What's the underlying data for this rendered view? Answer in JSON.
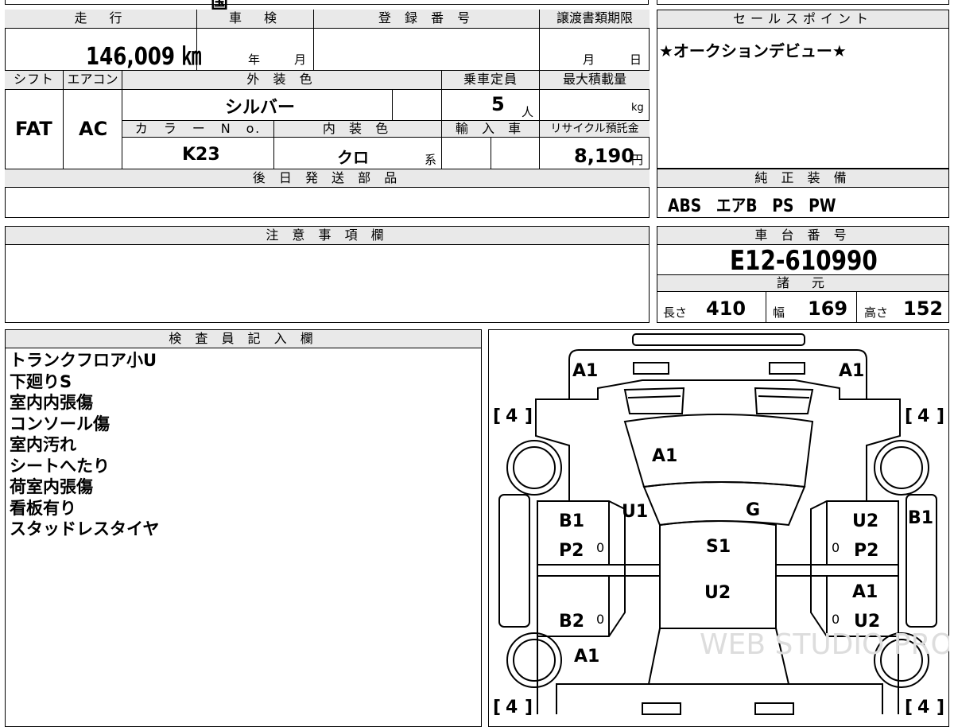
{
  "top_partial": {
    "item1": "国",
    "item2": "月",
    "item3": ""
  },
  "mileage": {
    "header": "走　行",
    "value": "146,009 ㎞"
  },
  "shaken": {
    "header": "車　検",
    "year": "年",
    "month": "月"
  },
  "registration": {
    "header": "登 録 番 号",
    "value": ""
  },
  "transfer": {
    "header": "譲渡書類期限",
    "month": "月",
    "day": "日"
  },
  "sales_point": {
    "header": "セールスポイント",
    "text": "★オークションデビュー★"
  },
  "shift": {
    "header": "シフト",
    "value": "FAT"
  },
  "aircon": {
    "header": "エアコン",
    "value": "AC"
  },
  "exterior_color": {
    "header": "外 装 色",
    "value": "シルバー"
  },
  "capacity": {
    "header": "乗車定員",
    "value": "5",
    "unit": "人"
  },
  "max_load": {
    "header": "最大積載量",
    "unit": "kg"
  },
  "color_no": {
    "header": "カ　ラ　ー　N　o.",
    "value": "K23"
  },
  "interior_color": {
    "header": "内 装 色",
    "value": "クロ",
    "suffix": "系"
  },
  "import": {
    "header": "輸 入 車"
  },
  "recycle": {
    "header": "リサイクル預託金",
    "value": "8,190",
    "unit": "円"
  },
  "later_parts": {
    "header": "後 日 発 送 部 品"
  },
  "genuine_equipment": {
    "header": "純 正 装 備",
    "value": "ABS　エアB　PS　PW"
  },
  "notes": {
    "header": "注 意 事 項 欄"
  },
  "chassis": {
    "header": "車 台 番 号",
    "value": "E12-610990"
  },
  "specs": {
    "header": "諸　元",
    "length_label": "長さ",
    "length": "410",
    "width_label": "幅",
    "width": "169",
    "height_label": "高さ",
    "height": "152"
  },
  "inspector": {
    "header": "検 査 員 記 入 欄",
    "lines": [
      "トランクフロア小U",
      "下廻りS",
      "室内内張傷",
      "コンソール傷",
      "室内汚れ",
      "シートへたり",
      "荷室内張傷",
      "看板有り",
      "スタッドレスタイヤ"
    ]
  },
  "diagram": {
    "front_left": "A1",
    "front_right": "A1",
    "tire_fl": "4",
    "tire_fr": "4",
    "tire_rl": "4",
    "tire_rr": "4",
    "hood": "A1",
    "fender_left": "U1",
    "fender_right": "G",
    "door_fl_a": "B1",
    "door_fl_b": "P2",
    "roof": "S1",
    "door_fr_a": "U2",
    "door_fr_b": "P2",
    "side_right": "B1",
    "door_rl": "B2",
    "rear_left": "A1",
    "roof_rear": "U2",
    "door_rr_a": "A1",
    "door_rr_b": "U2",
    "zero": "0",
    "watermark": "WEB STUDIO PRO"
  }
}
